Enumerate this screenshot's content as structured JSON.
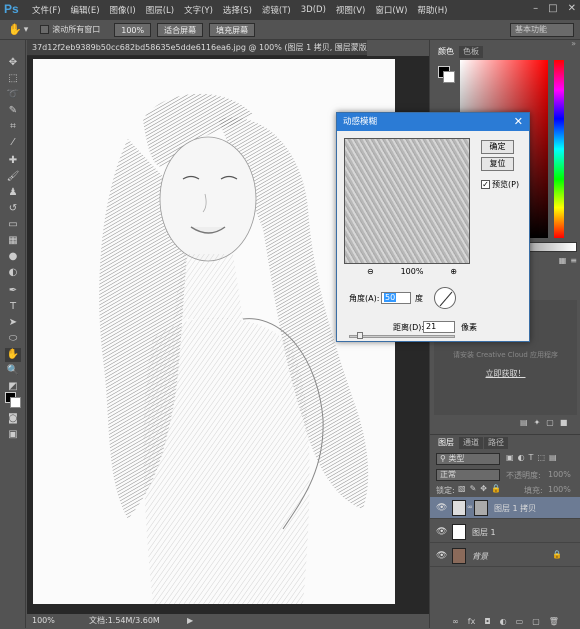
{
  "app": {
    "logo": "Ps"
  },
  "menu": [
    "文件(F)",
    "编辑(E)",
    "图像(I)",
    "图层(L)",
    "文字(Y)",
    "选择(S)",
    "滤镜(T)",
    "3D(D)",
    "视图(V)",
    "窗口(W)",
    "帮助(H)"
  ],
  "options": {
    "scroll_all_label": "滚动所有窗口",
    "zoom_100": "100%",
    "fit_screen": "适合屏幕",
    "fill_screen": "填充屏幕",
    "workspace": "基本功能"
  },
  "document": {
    "tab_title": "37d12f2eb9389b50cc682bd58635e5dde6116ea6.jpg @ 100% (图层 1 拷贝, 图层蒙版/8) *",
    "zoom": "100%",
    "doc_size": "文档:1.54M/3.60M"
  },
  "color_panel": {
    "tabs": [
      "颜色",
      "色板"
    ]
  },
  "promo": {
    "line1": "请安装 Creative Cloud 应用程序",
    "cta": "立即获取！"
  },
  "layers_panel": {
    "tabs": [
      "图层",
      "通道",
      "路径"
    ],
    "kind": "类型",
    "blend_mode": "正常",
    "opacity_label": "不透明度:",
    "opacity_value": "100%",
    "lock_label": "锁定:",
    "fill_label": "填充:",
    "fill_value": "100%",
    "layers": [
      {
        "name": "图层 1 拷贝",
        "selected": true
      },
      {
        "name": "图层 1",
        "selected": false
      },
      {
        "name": "背景",
        "selected": false
      }
    ]
  },
  "dialog": {
    "title": "动感模糊",
    "ok": "确定",
    "reset": "复位",
    "preview": "预览(P)",
    "zoom": "100%",
    "angle_label": "角度(A):",
    "angle_value": "50",
    "angle_unit": "度",
    "distance_label": "距离(D):",
    "distance_value": "21",
    "distance_unit": "像素"
  }
}
